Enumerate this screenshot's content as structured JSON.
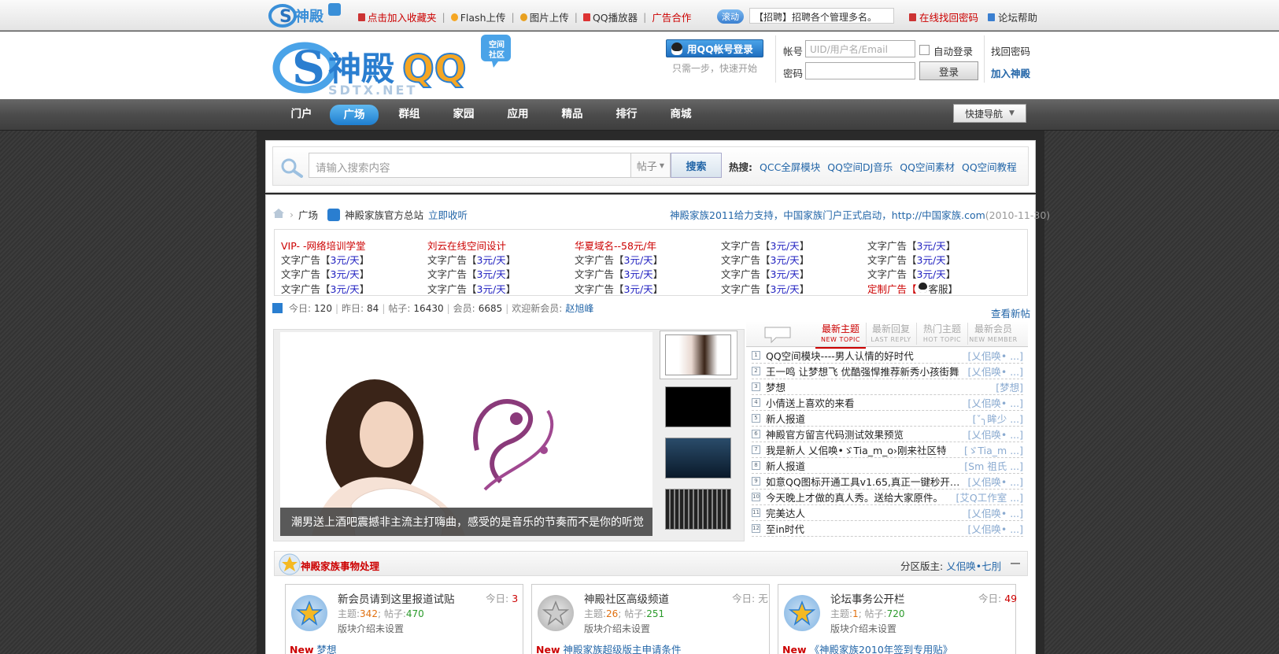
{
  "top": {
    "logo_alt": "神殿",
    "links": [
      {
        "label": "点击加入收藏夹",
        "color": "#cc0000",
        "icon": "bookmark-icon"
      },
      {
        "label": "Flash上传",
        "color": "#333333",
        "icon": "flash-icon"
      },
      {
        "label": "图片上传",
        "color": "#333333",
        "icon": "image-icon"
      },
      {
        "label": "QQ播放器",
        "color": "#333333",
        "icon": "player-icon"
      },
      {
        "label": "广告合作",
        "color": "#cc0000",
        "icon": ""
      }
    ],
    "scroll_tag": "滚动",
    "scroll_text": "【招聘】招聘各个管理多名。",
    "find_password": "在线找回密码",
    "forum_help": "论坛帮助"
  },
  "login": {
    "qq_login_label": "用QQ帐号登录",
    "qq_hint": "只需一步，快速开始",
    "account_label": "帐号",
    "account_placeholder": "UID/用户名/Email",
    "password_label": "密码",
    "auto_login_label": "自动登录",
    "retrieve_password": "找回密码",
    "login_button": "登录",
    "join": "加入神殿"
  },
  "nav": {
    "items": [
      "门户",
      "广场",
      "群组",
      "家园",
      "应用",
      "精品",
      "排行",
      "商城"
    ],
    "active_index": 1,
    "quick_nav": "快捷导航"
  },
  "search": {
    "placeholder": "请输入搜索内容",
    "type": "帖子",
    "button": "搜索",
    "hot_label": "热搜:",
    "hot_words": [
      "QCC全屏模块",
      "QQ空间DJ音乐",
      "QQ空间素材",
      "QQ空间教程"
    ]
  },
  "breadcrumb": {
    "home_icon": "home-icon",
    "section": "广场",
    "site": "神殿家族官方总站",
    "collect": "立即收听"
  },
  "announcement": {
    "text": "神殿家族2011给力支持，中国家族门户正式启动，http://中国家族.com",
    "date": "(2010-11-30)"
  },
  "ads": {
    "row1": [
      "VIP- -网络培训学堂",
      "刘云在线空间设计",
      "华夏域名--58元/年"
    ],
    "text_ad_prefix": "文字广告【",
    "text_ad_price": "3元/天",
    "text_ad_suffix": "】",
    "custom_ad_label": "定制广告【",
    "custom_ad_service": "客服",
    "custom_ad_suffix": "】"
  },
  "stats": {
    "today_label": "今日:",
    "today": "120",
    "yesterday_label": "昨日:",
    "yesterday": "84",
    "posts_label": "帖子:",
    "posts": "16430",
    "members_label": "会员:",
    "members": "6685",
    "welcome_label": "欢迎新会员:",
    "newest_member": "赵旭峰",
    "view_new": "查看新帖"
  },
  "slide": {
    "caption": "潮男送上酒吧震撼非主流主打嗨曲，感受的是音乐的节奏而不是你的听觉"
  },
  "topic_tabs": [
    {
      "label": "最新主题",
      "sub": "NEW TOPIC",
      "active": true
    },
    {
      "label": "最新回复",
      "sub": "LAST REPLY",
      "active": false
    },
    {
      "label": "热门主题",
      "sub": "HOT TOPIC",
      "active": false
    },
    {
      "label": "最新会员",
      "sub": "NEW MEMBER",
      "active": false
    }
  ],
  "topics": [
    {
      "n": "1",
      "title": "QQ空间模块----男人认情的好时代",
      "author": "[乂佀唤• ...]"
    },
    {
      "n": "2",
      "title": "王一鸣 让梦想飞 优酷强悍推荐新秀小孩街舞",
      "author": "[乂佀唤• ...]"
    },
    {
      "n": "3",
      "title": "梦想",
      "author": "[梦想]"
    },
    {
      "n": "4",
      "title": "小倩送上喜欢的来看",
      "author": "[乂佀唤• ...]"
    },
    {
      "n": "5",
      "title": "新人报道",
      "author": "[ˇ╮眸少 ...]"
    },
    {
      "n": "6",
      "title": "神殿官方留言代码测试效果预览",
      "author": "[乂佀唤• ...]"
    },
    {
      "n": "7",
      "title": "我是新人 乂佀唤•ゞTia_m_o›刚来社区特",
      "author": "[ゞTia_m ...]"
    },
    {
      "n": "8",
      "title": "新人报道",
      "author": "[Sm 祖氏 ...]"
    },
    {
      "n": "9",
      "title": "如意QQ图标开通工具v1.65,真正一键秒开钻石 ...",
      "author": "[乂佀唤• ...]"
    },
    {
      "n": "10",
      "title": "今天晚上才做的真人秀。送给大家原件。",
      "author": "[艾Q工作室 ...]"
    },
    {
      "n": "11",
      "title": "完美达人",
      "author": "[乂佀唤• ...]"
    },
    {
      "n": "12",
      "title": "至in时代",
      "author": "[乂佀唤• ...]"
    }
  ],
  "section": {
    "title": "神殿家族事物处理",
    "moderator_label": "分区版主:",
    "moderator": "乂佀唤•七刖",
    "collapse_icon": "minus-icon"
  },
  "forums": [
    {
      "name": "新会员请到这里报道试贴",
      "today_label": "今日:",
      "today": "3",
      "topics_label": "主题:",
      "topics": "342",
      "posts_label": "帖子:",
      "posts": "470",
      "desc": "版块介绍未设置",
      "new_label": "New",
      "last": "梦想",
      "active": true
    },
    {
      "name": "神殿社区高级频道",
      "today_label": "今日:",
      "today": "无",
      "topics_label": "主题:",
      "topics": "26",
      "posts_label": "帖子:",
      "posts": "251",
      "desc": "版块介绍未设置",
      "new_label": "New",
      "last": "神殿家族超级版主申请条件",
      "active": false
    },
    {
      "name": "论坛事务公开栏",
      "today_label": "今日:",
      "today": "49",
      "topics_label": "主题:",
      "topics": "1",
      "posts_label": "帖子:",
      "posts": "720",
      "desc": "版块介绍未设置",
      "new_label": "New",
      "last": "《神殿家族2010年签到专用贴》",
      "active": true
    }
  ],
  "colors": {
    "link_blue": "#2366a8",
    "red": "#cc0000",
    "nav_active": "#1e7ed0"
  }
}
